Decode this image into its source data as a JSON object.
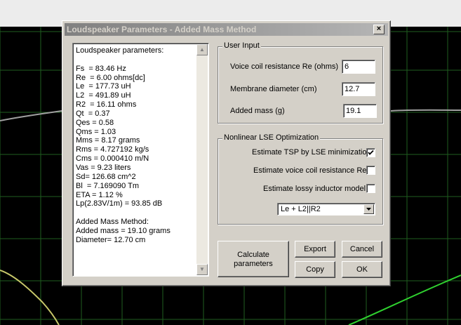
{
  "window": {
    "title": "Loudspeaker Parameters - Added Mass Method",
    "close_symbol": "×"
  },
  "results": {
    "lines": [
      "Loudspeaker parameters:",
      "",
      "Fs  = 83.46 Hz",
      "Re  = 6.00 ohms[dc]",
      "Le  = 177.73 uH",
      "L2  = 491.89 uH",
      "R2  = 16.11 ohms",
      "Qt  = 0.37",
      "Qes = 0.58",
      "Qms = 1.03",
      "Mms = 8.17 grams",
      "Rms = 4.727192 kg/s",
      "Cms = 0.000410 m/N",
      "Vas = 9.23 liters",
      "Sd= 126.68 cm^2",
      "Bl  = 7.169090 Tm",
      "ETA = 1.12 %",
      "Lp(2.83V/1m) = 93.85 dB",
      "",
      "Added Mass Method:",
      "Added mass = 19.10 grams",
      "Diameter= 12.70 cm"
    ]
  },
  "user_input": {
    "group_label": "User Input",
    "re_label": "Voice coil resistance Re (ohms)",
    "re_value": "6",
    "diameter_label": "Membrane diameter (cm)",
    "diameter_value": "12.7",
    "mass_label": "Added mass (g)",
    "mass_value": "19.1"
  },
  "lse": {
    "group_label": "Nonlinear LSE Optimization",
    "opt_tsp_label": "Estimate TSP by LSE minimization",
    "opt_tsp_checked": true,
    "opt_re_label": "Estimate voice coil resistance Re",
    "opt_re_checked": false,
    "opt_lossy_label": "Estimate lossy inductor model",
    "opt_lossy_checked": false,
    "model_selected": "Le + L2||R2"
  },
  "buttons": {
    "calculate_line1": "Calculate",
    "calculate_line2": "parameters",
    "export": "Export",
    "cancel": "Cancel",
    "copy": "Copy",
    "ok": "OK"
  },
  "colors": {
    "grid": "#1f5e1f",
    "gray_curve": "#a0a0a0",
    "yellow_curve": "#c8c86a",
    "green_curve": "#2fd12f"
  }
}
